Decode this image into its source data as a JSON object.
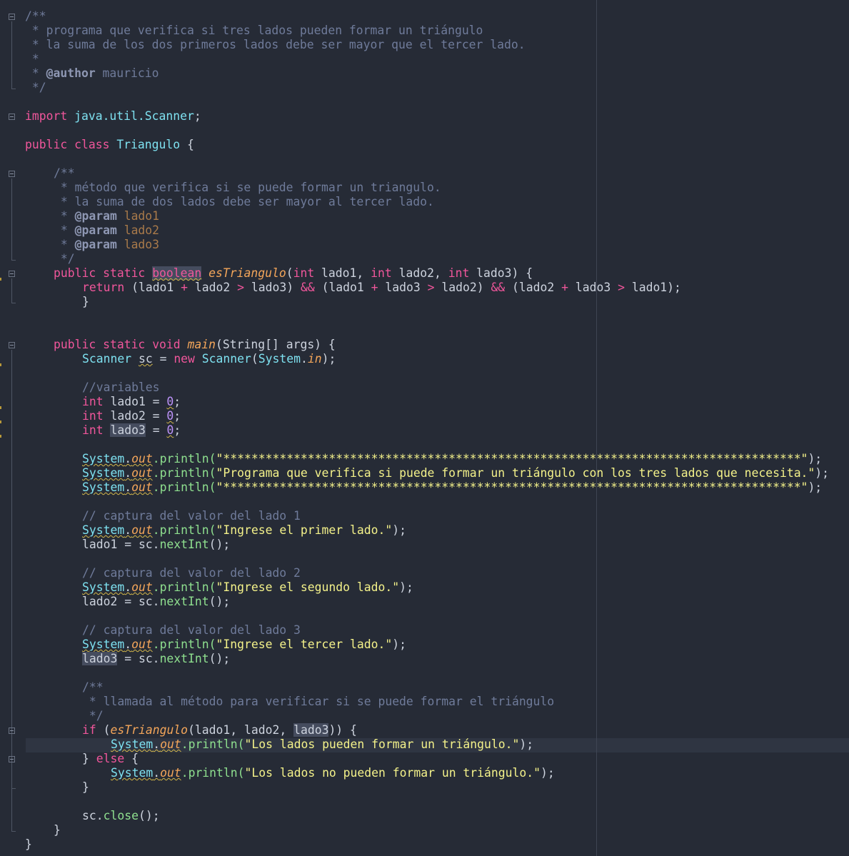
{
  "editor": {
    "language": "Java",
    "file_class": "Triangulo"
  },
  "code": {
    "l1": "/**",
    "l2": " * programa que verifica si tres lados pueden formar un triángulo",
    "l3": " * la suma de los dos primeros lados debe ser mayor que el tercer lado.",
    "l4": " *",
    "l5_star": " * ",
    "l5_tag": "@author",
    "l5_rest": " mauricio",
    "l6": " */",
    "import_kw": "import",
    "import_pkg": "java.util.",
    "import_cls": "Scanner",
    "import_end": ";",
    "class_pub": "public",
    "class_kw": "class",
    "class_name": "Triangulo",
    "class_open": " {",
    "jd_open": "/**",
    "jd_1": " * método que verifica si se puede formar un triangulo.",
    "jd_2": " * la suma de dos lados debe ser mayor al tercer lado.",
    "jd_star": " * ",
    "jd_param": "@param",
    "jd_p1": " lado1",
    "jd_p2": " lado2",
    "jd_p3": " lado3",
    "jd_close": " */",
    "m1_public": "public",
    "m1_static": "static",
    "m1_bool": "boolean",
    "m1_name": "esTriangulo",
    "m1_sig_a": "(",
    "m1_int": "int",
    "m1_p1": " lado1, ",
    "m1_p2": " lado2, ",
    "m1_p3": " lado3) {",
    "ret_kw": "return",
    "ret_a": " (lado1 ",
    "plus": "+",
    "ret_b": " lado2 ",
    "gt": ">",
    "ret_c": " lado3) ",
    "and": "&&",
    "ret_d": " (lado1 ",
    "ret_e": " lado3 ",
    "ret_f": " lado2) ",
    "ret_g": " (lado2 ",
    "ret_h": " lado3 ",
    "ret_i": " lado1);",
    "close_brace": "}",
    "m2_public": "public",
    "m2_static": "static",
    "m2_void": "void",
    "m2_name": "main",
    "m2_sig": "(String[] args) {",
    "sc_type": "Scanner",
    "sc_var": "sc",
    "sc_eq": " = ",
    "sc_new": "new",
    "sc_cls": "Scanner",
    "sc_arg_a": "(",
    "sc_sys": "System",
    "sc_dot": ".",
    "sc_in": "in",
    "sc_end": ");",
    "cm_vars": "//variables",
    "var_int": "int",
    "v1": " lado1 = ",
    "v2": " lado2 = ",
    "v3_name": "lado3",
    "v3_eq": " = ",
    "zero": "0",
    "semi": ";",
    "sys": "System",
    "dot": ".",
    "out": "out",
    "println": ".println(",
    "stars": "\"**********************************************************************************\"",
    "prog_msg": "\"Programa que verifica si puede formar un triángulo con los tres lados que necesita.\"",
    "end_call": ");",
    "cm_1": "// captura del valor del lado 1",
    "msg_1": "\"Ingrese el primer lado.\"",
    "read_1_a": "lado1 = sc.",
    "next_int": "nextInt",
    "read_end": "();",
    "cm_2": "// captura del valor del lado 2",
    "msg_2": "\"Ingrese el segundo lado.\"",
    "read_2_a": "lado2 = sc.",
    "cm_3": "// captura del valor del lado 3",
    "msg_3": "\"Ingrese el tercer lado.\"",
    "read_3_var": "lado3",
    "read_3_a": " = sc.",
    "bc_open": "/**",
    "bc_1": " * llamada al método para verificar si se puede formar el triángulo",
    "bc_close": " */",
    "if_kw": "if",
    "if_a": " (",
    "if_fn": "esTriangulo",
    "if_b": "(lado1, lado2, ",
    "if_c": "lado3",
    "if_d": ")) {",
    "msg_yes": "\"Los lados pueden formar un triángulo.\"",
    "else_a": "} ",
    "else_kw": "else",
    "else_b": " {",
    "close_a": "sc.",
    "close_fn": "close",
    "close_b": "();"
  }
}
